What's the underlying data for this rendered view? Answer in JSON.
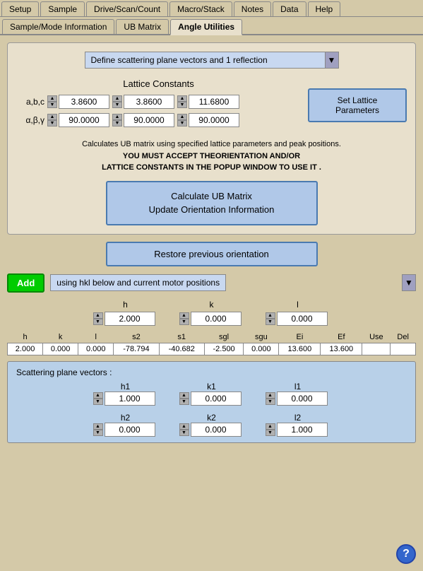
{
  "menubar": {
    "items": [
      "Setup",
      "Sample",
      "Drive/Scan/Count",
      "Macro/Stack",
      "Notes",
      "Data",
      "Help"
    ]
  },
  "tabs": {
    "items": [
      "Sample/Mode Information",
      "UB Matrix",
      "Angle Utilities"
    ],
    "active": 2
  },
  "dropdown": {
    "value": "Define scattering plane vectors and 1 reflection",
    "arrow": "▼"
  },
  "lattice": {
    "title": "Lattice Constants",
    "label_abc": "a,b,c",
    "label_abg": "α,β,γ",
    "a": "3.8600",
    "b": "3.8600",
    "c": "11.6800",
    "alpha": "90.0000",
    "beta": "90.0000",
    "gamma": "90.0000",
    "set_btn": "Set Lattice Parameters"
  },
  "info": {
    "line1": "Calculates UB matrix using specified lattice parameters and peak positions.",
    "line2": "YOU MUST ACCEPT THEORIENTATION AND/OR",
    "line3": "LATTICE CONSTANTS IN THE POPUP WINDOW TO USE IT ."
  },
  "calc_btn": {
    "line1": "Calculate UB Matrix",
    "line2": "Update Orientation Information"
  },
  "restore_btn": "Restore previous orientation",
  "add_section": {
    "add_label": "Add",
    "dropdown_value": "using hkl below and current motor positions",
    "arrow": "▼"
  },
  "hkl_inputs": {
    "h_label": "h",
    "k_label": "k",
    "l_label": "l",
    "h_value": "2.000",
    "k_value": "0.000",
    "l_value": "0.000"
  },
  "table": {
    "headers": [
      "h",
      "k",
      "l",
      "s2",
      "s1",
      "sgl",
      "sgu",
      "Ei",
      "Ef",
      "Use",
      "Del"
    ],
    "row": [
      "2.000",
      "0.000",
      "0.000",
      "-78.794",
      "-40.682",
      "-2.500",
      "0.000",
      "13.600",
      "13.600",
      "",
      ""
    ]
  },
  "scatter": {
    "title": "Scattering plane vectors :",
    "h1_label": "h1",
    "k1_label": "k1",
    "l1_label": "l1",
    "h1_value": "1.000",
    "k1_value": "0.000",
    "l1_value": "0.000",
    "h2_label": "h2",
    "k2_label": "k2",
    "l2_label": "l2",
    "h2_value": "0.000",
    "k2_value": "0.000",
    "l2_value": "1.000"
  },
  "help_btn": "?"
}
